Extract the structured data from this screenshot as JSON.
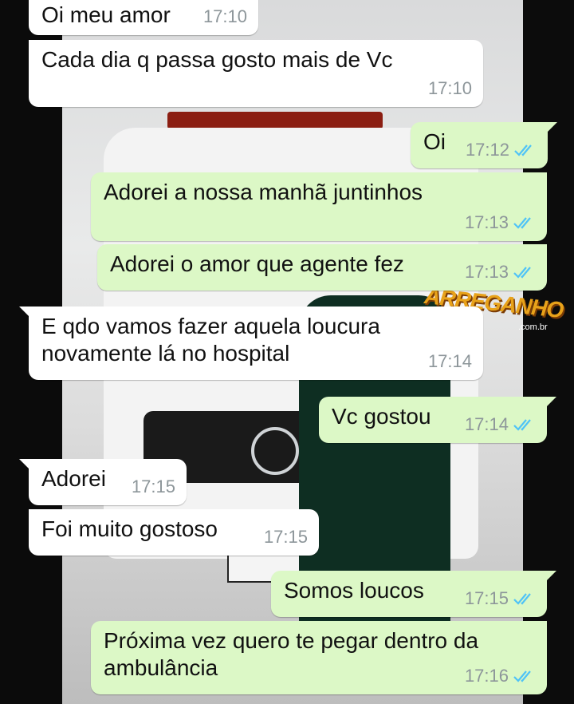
{
  "colors": {
    "incoming": "#ffffff",
    "outgoing": "#dcf8c6",
    "read_ticks": "#4fc3f7",
    "time": "#8d969a"
  },
  "watermark": {
    "main": "ARREGANHO",
    "sub": ".com.br"
  },
  "messages": [
    {
      "text": "Oi meu amor",
      "time": "17:10",
      "dir": "in"
    },
    {
      "text": "Cada dia q passa gosto mais de Vc",
      "time": "17:10",
      "dir": "in"
    },
    {
      "text": "Oi",
      "time": "17:12",
      "dir": "out",
      "status": "read-ticks"
    },
    {
      "text": "Adorei a nossa manhã juntinhos",
      "time": "17:13",
      "dir": "out",
      "status": "read-ticks"
    },
    {
      "text": "Adorei o amor que agente fez",
      "time": "17:13",
      "dir": "out",
      "status": "read-ticks"
    },
    {
      "line1": "E qdo vamos fazer aquela loucura",
      "line2": "novamente lá no hospital",
      "time": "17:14",
      "dir": "in"
    },
    {
      "text": "Vc gostou",
      "time": "17:14",
      "dir": "out",
      "status": "read-ticks"
    },
    {
      "text": "Adorei",
      "time": "17:15",
      "dir": "in"
    },
    {
      "text": "Foi muito gostoso",
      "time": "17:15",
      "dir": "in"
    },
    {
      "text": "Somos loucos",
      "time": "17:15",
      "dir": "out",
      "status": "read-ticks"
    },
    {
      "line1": "Próxima vez quero te pegar dentro da",
      "line2": "ambulância",
      "time": "17:16",
      "dir": "out",
      "status": "read-ticks"
    }
  ]
}
